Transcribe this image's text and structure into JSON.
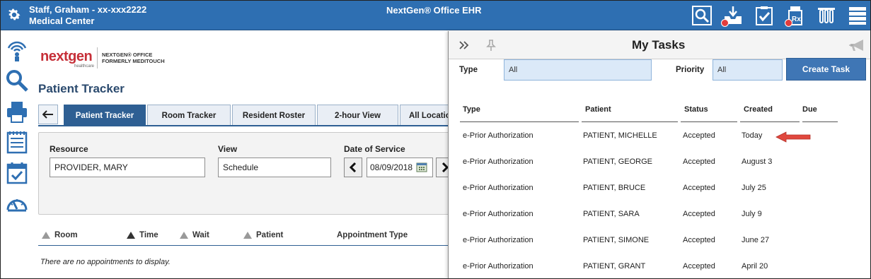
{
  "topbar": {
    "user_line1": "Staff, Graham - xx-xxx2222",
    "user_line2": "Medical Center",
    "app_title": "NextGen® Office EHR",
    "icons": [
      "search-icon",
      "inbox-download-icon",
      "clipboard-check-icon",
      "rx-bottle-icon",
      "lab-tubes-icon",
      "list-menu-icon"
    ],
    "alert_color": "#e23c3c",
    "bar_color": "#2e6fb2"
  },
  "rail": {
    "icons": [
      "signal-person-icon",
      "search-icon",
      "printer-icon",
      "notepad-icon",
      "calendar-check-icon",
      "gauge-icon"
    ]
  },
  "main": {
    "logo_text": "nextgen",
    "logo_sub": "healthcare",
    "logo_tag_line1": "NEXTGEN® OFFICE",
    "logo_tag_line2": "FORMERLY MEDITOUCH",
    "page_title": "Patient Tracker",
    "tabs": [
      {
        "label": "Patient Tracker",
        "active": true
      },
      {
        "label": "Room Tracker",
        "active": false
      },
      {
        "label": "Resident Roster",
        "active": false
      },
      {
        "label": "2-hour View",
        "active": false
      },
      {
        "label": "All Locations",
        "active": false
      }
    ],
    "filters": {
      "resource_label": "Resource",
      "resource_value": "PROVIDER, MARY",
      "view_label": "View",
      "view_value": "Schedule",
      "date_label": "Date of Service",
      "date_value": "08/09/2018"
    },
    "columns": [
      "Room",
      "Time",
      "Wait",
      "Patient",
      "Appointment Type"
    ],
    "empty_message": "There are no appointments to display."
  },
  "tasks": {
    "title": "My Tasks",
    "type_label": "Type",
    "type_value": "All",
    "priority_label": "Priority",
    "priority_value": "All",
    "create_button": "Create Task",
    "headers": [
      "Type",
      "Patient",
      "Status",
      "Created",
      "Due"
    ],
    "rows": [
      {
        "type": "e-Prior Authorization",
        "patient": "PATIENT, MICHELLE",
        "status": "Accepted",
        "created": "Today",
        "due": ""
      },
      {
        "type": "e-Prior Authorization",
        "patient": "PATIENT, GEORGE",
        "status": "Accepted",
        "created": "August 3",
        "due": ""
      },
      {
        "type": "e-Prior Authorization",
        "patient": "PATIENT, BRUCE",
        "status": "Accepted",
        "created": "July 25",
        "due": ""
      },
      {
        "type": "e-Prior Authorization",
        "patient": "PATIENT, SARA",
        "status": "Accepted",
        "created": "July 9",
        "due": ""
      },
      {
        "type": "e-Prior Authorization",
        "patient": "PATIENT, SIMONE",
        "status": "Accepted",
        "created": "June 27",
        "due": ""
      },
      {
        "type": "e-Prior Authorization",
        "patient": "PATIENT, GRANT",
        "status": "Accepted",
        "created": "April 20",
        "due": ""
      }
    ],
    "pointer_color": "#e0483e"
  }
}
